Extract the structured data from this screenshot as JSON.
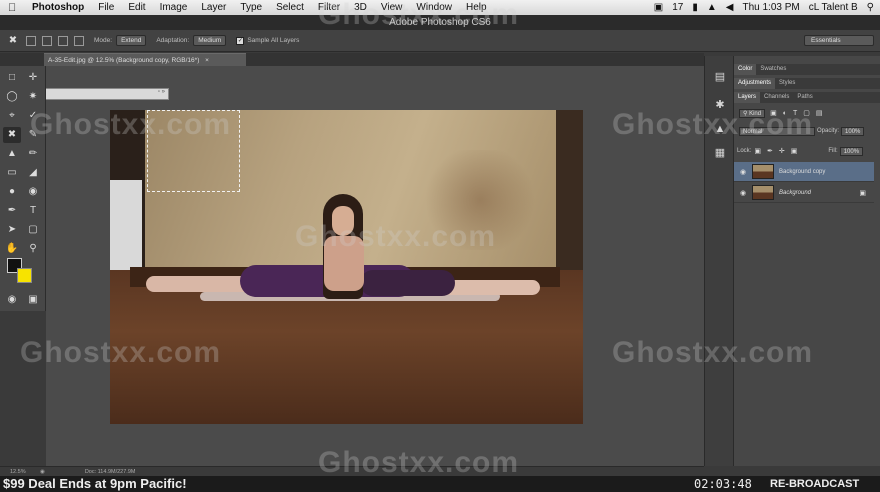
{
  "menubar": {
    "app": "Photoshop",
    "items": [
      "File",
      "Edit",
      "Image",
      "Layer",
      "Type",
      "Select",
      "Filter",
      "3D",
      "View",
      "Window",
      "Help"
    ],
    "status_badge": "17",
    "clock": "Thu 1:03 PM",
    "user": "cL Talent B"
  },
  "window_title": "Adobe Photoshop CS6",
  "options": {
    "mode_label": "Mode:",
    "mode_value": "Extend",
    "adaptation_label": "Adaptation:",
    "adaptation_value": "Medium",
    "sample_all_layers": "Sample All Layers",
    "workspace": "Essentials"
  },
  "document": {
    "tab_title": "A-35-Edit.jpg @ 12.5% (Background copy, RGB/16*)"
  },
  "panels": {
    "color_tabs": [
      "Color",
      "Swatches"
    ],
    "adjustment_tabs": [
      "Adjustments",
      "Styles"
    ],
    "layer_tabs": [
      "Layers",
      "Channels",
      "Paths"
    ],
    "kind_filter": "Kind",
    "blend_mode": "Normal",
    "opacity_label": "Opacity:",
    "opacity_value": "100%",
    "lock_label": "Lock:",
    "fill_label": "Fill:",
    "fill_value": "100%",
    "layers": [
      {
        "name": "Background copy",
        "selected": true
      },
      {
        "name": "Background",
        "selected": false
      }
    ]
  },
  "status": {
    "zoom": "12.5%",
    "doc_info": "Doc: 114.9M/227.9M"
  },
  "broadcast": {
    "deal": "$99 Deal Ends at 9pm Pacific!",
    "timer": "02:03:48",
    "rebroadcast": "RE-BROADCAST"
  },
  "watermark": "Ghostxx.com",
  "colors": {
    "foreground": "#111111",
    "background": "#f7e300",
    "selected_layer": "#5a6e88"
  }
}
